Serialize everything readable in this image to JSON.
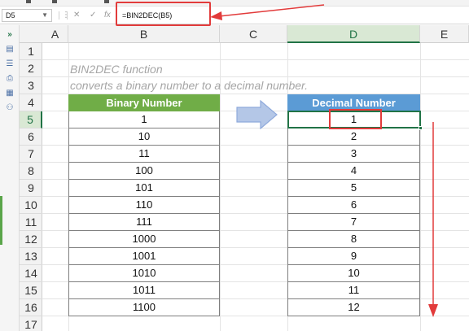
{
  "formula_bar": {
    "name_box": "D5",
    "cancel_icon": "close-icon",
    "confirm_icon": "check-icon",
    "function_icon": "fx-icon",
    "formula": "=BIN2DEC(B5)"
  },
  "columns": [
    "A",
    "B",
    "C",
    "D",
    "E"
  ],
  "selected_column": "D",
  "rows": [
    "1",
    "2",
    "3",
    "4",
    "5",
    "6",
    "7",
    "8",
    "9",
    "10",
    "11",
    "12",
    "13",
    "14",
    "15",
    "16",
    "17"
  ],
  "selected_row": "5",
  "description": {
    "line1": "BIN2DEC  function",
    "line2": "converts a binary number to a decimal number."
  },
  "binary_table": {
    "header": "Binary Number",
    "header_color": "#70ad47",
    "values": [
      "1",
      "10",
      "11",
      "100",
      "101",
      "110",
      "111",
      "1000",
      "1001",
      "1010",
      "1011",
      "1100"
    ]
  },
  "decimal_table": {
    "header": "Decimal Number",
    "header_color": "#5b9bd5",
    "values": [
      "1",
      "2",
      "3",
      "4",
      "5",
      "6",
      "7",
      "8",
      "9",
      "10",
      "11",
      "12"
    ]
  },
  "colors": {
    "selection": "#217346",
    "annotation": "#e23b3b",
    "arrow_fill": "#b4c7e7",
    "arrow_stroke": "#8faadc"
  }
}
